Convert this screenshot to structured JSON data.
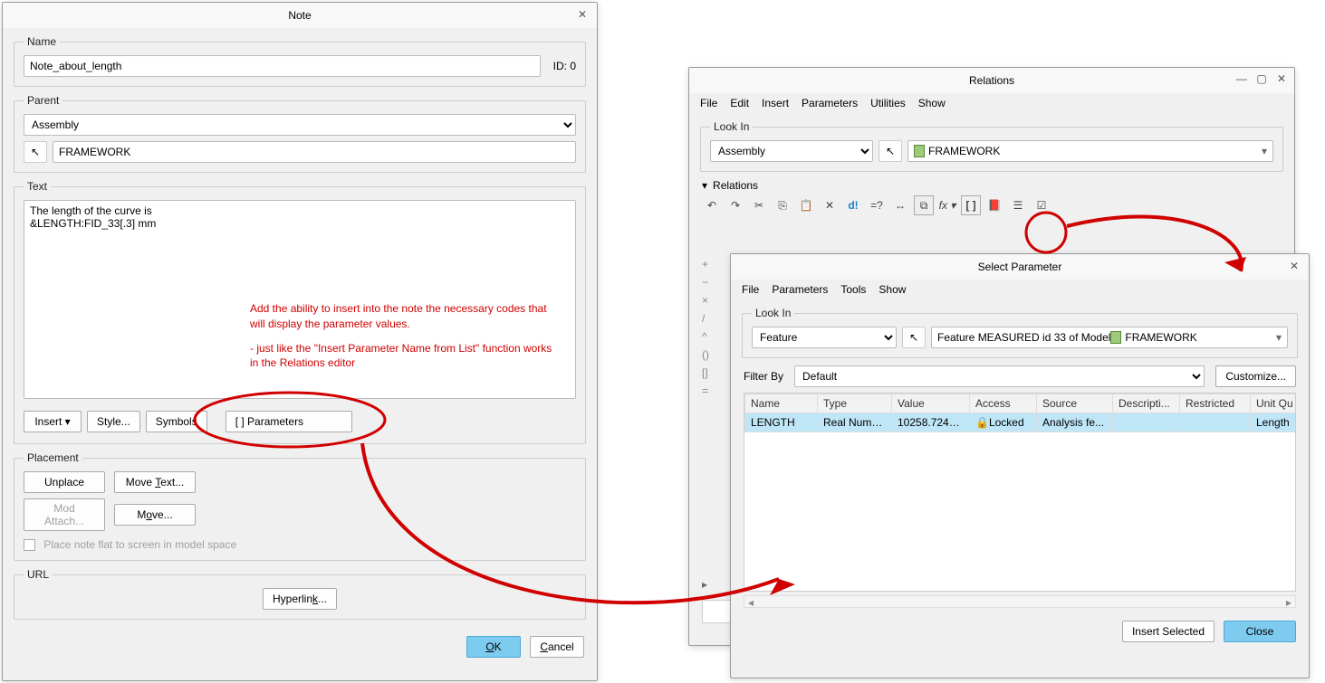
{
  "note_dialog": {
    "title": "Note",
    "name_legend": "Name",
    "name_value": "Note_about_length",
    "id_label": "ID: 0",
    "parent_legend": "Parent",
    "parent_value": "Assembly",
    "framework_value": "FRAMEWORK",
    "text_legend": "Text",
    "text_value": "The length of the curve is\n&LENGTH:FID_33[.3] mm",
    "annotation_line1": "Add the ability to insert into the note the necessary codes that will display the parameter values.",
    "annotation_line2": "- just like the \"Insert Parameter Name from List\" function works in the Relations editor",
    "insert_btn": "Insert",
    "style_btn": "Style...",
    "symbols_btn": "Symbols",
    "parameters_btn": "[ ] Parameters",
    "placement_legend": "Placement",
    "unplace_btn": "Unplace",
    "move_text_btn": "Move Text...",
    "mod_attach_btn": "Mod Attach...",
    "move_btn": "Move...",
    "flat_checkbox_label": "Place note flat to screen in model space",
    "url_legend": "URL",
    "hyperlink_btn": "Hyperlink...",
    "ok_btn": "OK",
    "cancel_btn": "Cancel"
  },
  "relations_dialog": {
    "title": "Relations",
    "menus": {
      "file": "File",
      "edit": "Edit",
      "insert": "Insert",
      "parameters": "Parameters",
      "utilities": "Utilities",
      "show": "Show"
    },
    "lookin_legend": "Look In",
    "lookin_value": "Assembly",
    "framework_value": "FRAMEWORK",
    "relations_header": "Relations",
    "side_symbols": {
      "plus": "+",
      "minus": "−",
      "times": "×",
      "divide": "/",
      "caret": "^",
      "paren": "()",
      "bracket": "[]",
      "equals": "="
    }
  },
  "select_param_dialog": {
    "title": "Select Parameter",
    "menus": {
      "file": "File",
      "parameters": "Parameters",
      "tools": "Tools",
      "show": "Show"
    },
    "lookin_legend": "Look In",
    "lookin_value": "Feature",
    "lookin_detail": "Feature MEASURED id 33 of Model ",
    "lookin_framework": "FRAMEWORK",
    "filter_label": "Filter By",
    "filter_value": "Default",
    "customize_btn": "Customize...",
    "columns": {
      "name": "Name",
      "type": "Type",
      "value": "Value",
      "access": "Access",
      "source": "Source",
      "description": "Descripti...",
      "restricted": "Restricted",
      "unit": "Unit Qu"
    },
    "row": {
      "name": "LENGTH",
      "type": "Real Numb...",
      "value": "10258.7246...",
      "access": "Locked",
      "source": "Analysis fe...",
      "description": "",
      "restricted": "",
      "unit": "Length"
    },
    "insert_selected_btn": "Insert Selected",
    "close_btn": "Close"
  }
}
